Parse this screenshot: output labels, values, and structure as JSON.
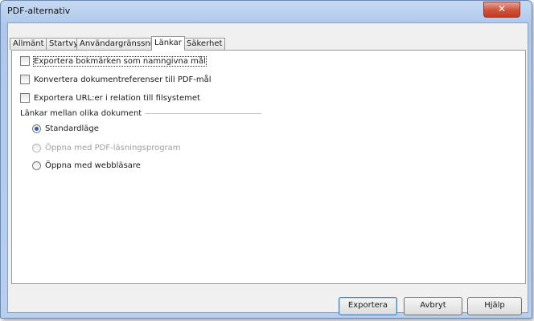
{
  "window": {
    "title": "PDF-alternativ",
    "close_glyph": "✕"
  },
  "tabs": [
    {
      "label": "Allmänt"
    },
    {
      "label": "Startvy"
    },
    {
      "label": "Användargränssnitt"
    },
    {
      "label": "Länkar",
      "active": true
    },
    {
      "label": "Säkerhet"
    }
  ],
  "options": {
    "export_bookmarks": {
      "label": "Exportera bokmärken som namngivna mål",
      "checked": false
    },
    "convert_references": {
      "label": "Konvertera dokumentreferenser till PDF-mål",
      "checked": false
    },
    "export_urls_relative": {
      "label": "Exportera URL:er i relation till filsystemet",
      "checked": false
    }
  },
  "cross_doc": {
    "group_title": "Länkar mellan olika dokument",
    "standard": {
      "label": "Standardläge",
      "selected": true
    },
    "pdf_reader": {
      "label": "Öppna med PDF-läsningsprogram",
      "disabled": true
    },
    "browser": {
      "label": "Öppna med webbläsare"
    }
  },
  "buttons": {
    "export": "Exportera",
    "cancel": "Avbryt",
    "help": "Hjälp"
  }
}
